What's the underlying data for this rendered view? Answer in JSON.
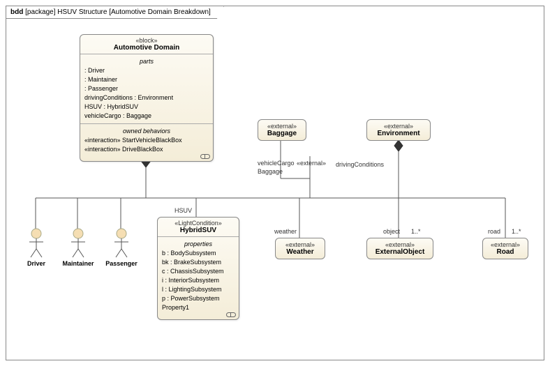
{
  "frame": {
    "kind": "bdd",
    "pkg_label": "[package]",
    "title": "HSUV Structure",
    "subtitle": "[Automotive Domain Breakdown]"
  },
  "automotiveDomain": {
    "stereotype": "«block»",
    "name": "Automotive Domain",
    "partsTitle": "parts",
    "parts": [
      " : Driver",
      " : Maintainer",
      " : Passenger",
      "drivingConditions : Environment",
      "HSUV : HybridSUV",
      "vehicleCargo : Baggage"
    ],
    "behaviorsTitle": "owned behaviors",
    "behaviors": [
      "«interaction» StartVehicleBlackBox",
      "«interaction» DriveBlackBox"
    ]
  },
  "hybridSUV": {
    "stereotype": "«LightCondition»",
    "name": "HybridSUV",
    "propsTitle": "properties",
    "props": [
      "b : BodySubsystem",
      "bk : BrakeSubsystem",
      "c : ChassisSubsystem",
      "i : InteriorSubsystem",
      "l : LightingSubsystem",
      "p : PowerSubsystem",
      "Property1"
    ]
  },
  "baggage": {
    "stereotype": "«external»",
    "name": "Baggage"
  },
  "environment": {
    "stereotype": "«external»",
    "name": "Environment"
  },
  "weather": {
    "stereotype": "«external»",
    "name": "Weather"
  },
  "externalObject": {
    "stereotype": "«external»",
    "name": "ExternalObject"
  },
  "road": {
    "stereotype": "«external»",
    "name": "Road"
  },
  "actors": {
    "driver": "Driver",
    "maintainer": "Maintainer",
    "passenger": "Passenger"
  },
  "labels": {
    "hsuv": "HSUV",
    "vehicleCargo": "vehicleCargo",
    "baggageRole": "Baggage",
    "external": "«external»",
    "drivingConditions": "drivingConditions",
    "weather": "weather",
    "object": "object",
    "road": "road",
    "mult1star_a": "1..*",
    "mult1star_b": "1..*"
  }
}
